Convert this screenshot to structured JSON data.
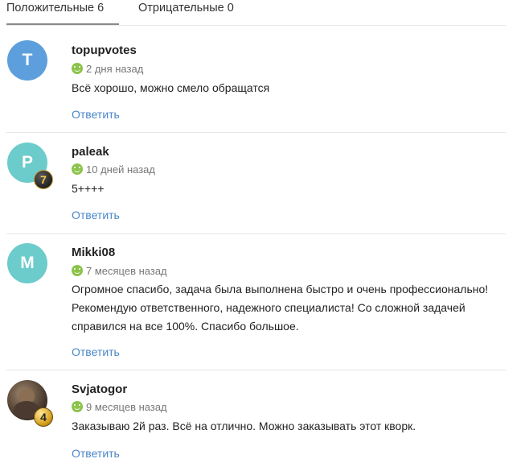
{
  "tabs": [
    {
      "label": "Положительные 6",
      "active": true
    },
    {
      "label": "Отрицательные 0",
      "active": false
    }
  ],
  "reviews": [
    {
      "username": "topupvotes",
      "avatar_letter": "T",
      "avatar_color": "#5d9fdc",
      "date": "2 дня назад",
      "text": "Всё хорошо, можно смело обращатся",
      "reply_label": "Ответить"
    },
    {
      "username": "paleak",
      "avatar_letter": "P",
      "avatar_color": "#6ccbcb",
      "level": "7",
      "date": "10 дней назад",
      "text": "5++++",
      "reply_label": "Ответить"
    },
    {
      "username": "Mikki08",
      "avatar_letter": "M",
      "avatar_color": "#6ccbcb",
      "date": "7 месяцев назад",
      "text": "Огромное спасибо, задача была выполнена быстро и очень профессионально! Рекомендую  ответственного, надежного специалиста! Со сложной задачей справился на все 100%. Спасибо большое.",
      "reply_label": "Ответить"
    },
    {
      "username": "Svjatogor",
      "avatar_type": "photo",
      "level": "4",
      "date": "9 месяцев назад",
      "text": "Заказываю 2й раз. Всё на отлично. Можно заказывать этот кворк.",
      "reply_label": "Ответить"
    }
  ],
  "colors": {
    "link": "#4a87c8",
    "positive_icon": "#8bc34a",
    "divider": "#e6e6e6"
  },
  "icons": {
    "rating": "smile-icon"
  }
}
